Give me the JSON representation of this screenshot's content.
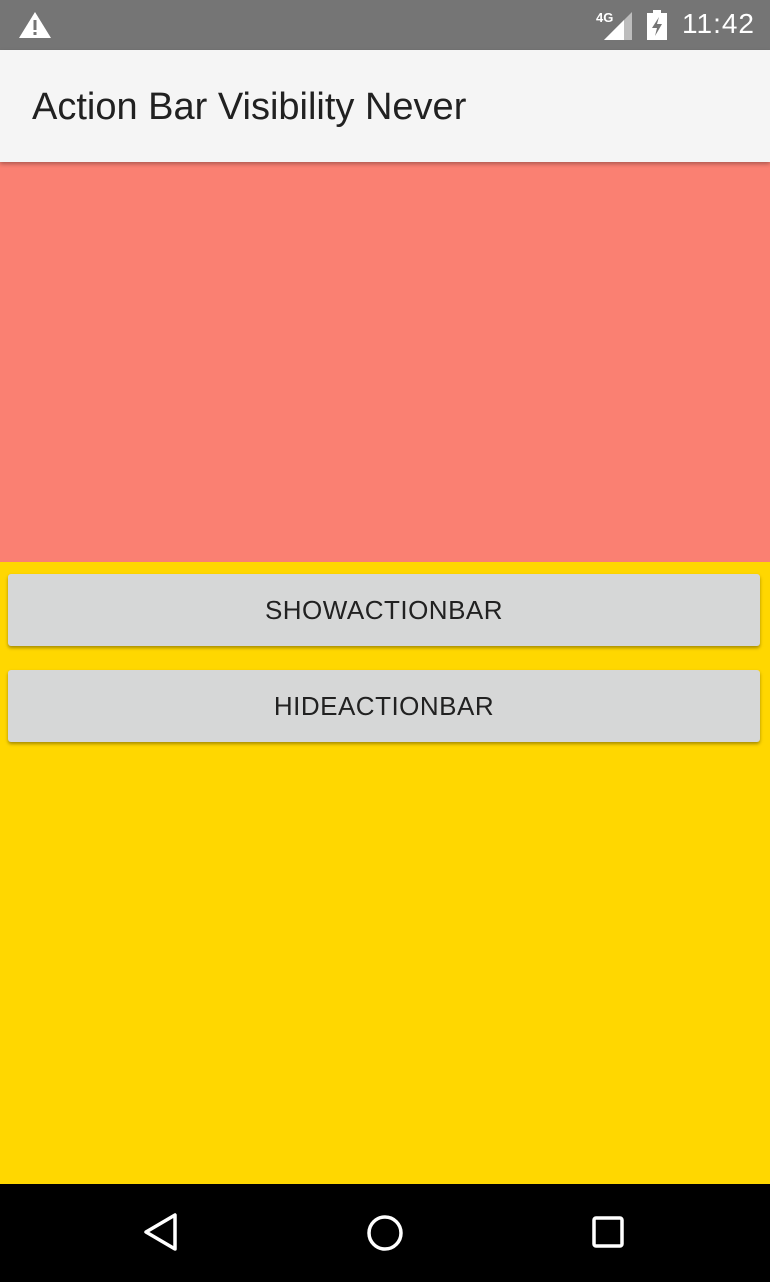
{
  "status_bar": {
    "warning_icon": "warning-icon",
    "network_label": "4G",
    "signal_icon": "signal-icon",
    "battery_icon": "battery-charging-icon",
    "time": "11:42",
    "color": "#757575"
  },
  "action_bar": {
    "title": "Action Bar Visibility Never",
    "background": "#f5f5f5"
  },
  "panels": {
    "top_color": "#fa8072",
    "bottom_color": "#ffd700"
  },
  "buttons": {
    "show_label": "SHOWACTIONBAR",
    "hide_label": "HIDEACTIONBAR"
  },
  "nav_bar": {
    "back_icon": "back-icon",
    "home_icon": "home-icon",
    "recents_icon": "recents-icon"
  }
}
